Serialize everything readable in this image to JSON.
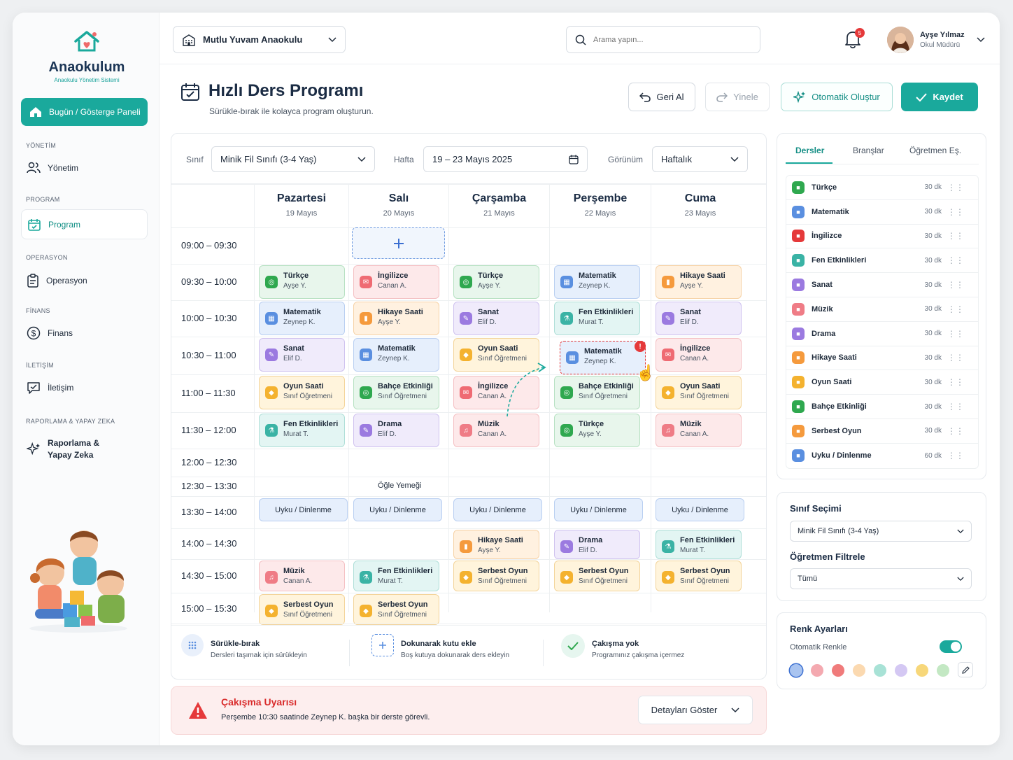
{
  "brand": {
    "name": "Anaokulum",
    "tagline": "Anaokulu Yönetim Sistemi"
  },
  "sidebar": {
    "dashboard_label": "Bugün / Gösterge Paneli",
    "sections": [
      {
        "title": "YÖNETİM",
        "item": "Yönetim",
        "icon": "users-icon"
      },
      {
        "title": "PROGRAM",
        "item": "Program",
        "icon": "calendar-icon",
        "active": true
      },
      {
        "title": "OPERASYON",
        "item": "Operasyon",
        "icon": "clipboard-icon"
      },
      {
        "title": "FİNANS",
        "item": "Finans",
        "icon": "dollar-icon"
      },
      {
        "title": "İLETİŞİM",
        "item": "İletişim",
        "icon": "chat-icon"
      },
      {
        "title": "RAPORLAMA & YAPAY ZEKA",
        "item": "Raporlama &",
        "item2": "Yapay Zeka",
        "icon": "sparkle-icon"
      }
    ]
  },
  "topbar": {
    "school": "Mutlu Yuvam Anaokulu",
    "search_placeholder": "Arama yapın...",
    "notifications": "5",
    "user_name": "Ayşe Yılmaz",
    "user_role": "Okul Müdürü"
  },
  "header": {
    "title": "Hızlı Ders Programı",
    "subtitle": "Sürükle-bırak ile kolayca program oluşturun.",
    "undo": "Geri Al",
    "redo": "Yinele",
    "auto": "Otomatik Oluştur",
    "save": "Kaydet"
  },
  "filters": {
    "class_label": "Sınıf",
    "class_value": "Minik Fil Sınıfı (3-4 Yaş)",
    "week_label": "Hafta",
    "week_value": "19 – 23 Mayıs 2025",
    "view_label": "Görünüm",
    "view_value": "Haftalık"
  },
  "days": [
    {
      "name": "Pazartesi",
      "date": "19 Mayıs"
    },
    {
      "name": "Salı",
      "date": "20 Mayıs"
    },
    {
      "name": "Çarşamba",
      "date": "21 Mayıs"
    },
    {
      "name": "Perşembe",
      "date": "22 Mayıs"
    },
    {
      "name": "Cuma",
      "date": "23 Mayıs"
    }
  ],
  "times": [
    "09:00 – 09:30",
    "09:30 – 10:00",
    "10:00 – 10:30",
    "10:30 – 11:00",
    "11:00 – 11:30",
    "11:30 – 12:00",
    "12:00 – 12:30",
    "12:30 – 13:30",
    "13:30 – 14:00",
    "14:00 – 14:30",
    "14:30 – 15:00",
    "15:00 – 15:30"
  ],
  "lunch": "Öğle Yemeği",
  "sleep_label": "Uyku / Dinlenme",
  "lessons": [
    {
      "day": 0,
      "slot": 1,
      "title": "Türkçe",
      "teacher": "Ayşe Y.",
      "color": "green"
    },
    {
      "day": 1,
      "slot": 1,
      "title": "İngilizce",
      "teacher": "Canan A.",
      "color": "red"
    },
    {
      "day": 2,
      "slot": 1,
      "title": "Türkçe",
      "teacher": "Ayşe Y.",
      "color": "green"
    },
    {
      "day": 3,
      "slot": 1,
      "title": "Matematik",
      "teacher": "Zeynep K.",
      "color": "blue"
    },
    {
      "day": 4,
      "slot": 1,
      "title": "Hikaye Saati",
      "teacher": "Ayşe Y.",
      "color": "orange"
    },
    {
      "day": 0,
      "slot": 2,
      "title": "Matematik",
      "teacher": "Zeynep K.",
      "color": "blue"
    },
    {
      "day": 1,
      "slot": 2,
      "title": "Hikaye Saati",
      "teacher": "Ayşe Y.",
      "color": "orange"
    },
    {
      "day": 2,
      "slot": 2,
      "title": "Sanat",
      "teacher": "Elif D.",
      "color": "purple"
    },
    {
      "day": 3,
      "slot": 2,
      "title": "Fen Etkinlikleri",
      "teacher": "Murat T.",
      "color": "teal"
    },
    {
      "day": 4,
      "slot": 2,
      "title": "Sanat",
      "teacher": "Elif D.",
      "color": "purple"
    },
    {
      "day": 0,
      "slot": 3,
      "title": "Sanat",
      "teacher": "Elif D.",
      "color": "purple"
    },
    {
      "day": 1,
      "slot": 3,
      "title": "Matematik",
      "teacher": "Zeynep K.",
      "color": "blue"
    },
    {
      "day": 2,
      "slot": 3,
      "title": "Oyun Saati",
      "teacher": "Sınıf Öğretmeni",
      "color": "yellow"
    },
    {
      "day": 3,
      "slot": 3,
      "title": "Matematik",
      "teacher": "Zeynep K.",
      "color": "blue",
      "conflict": true
    },
    {
      "day": 4,
      "slot": 3,
      "title": "İngilizce",
      "teacher": "Canan A.",
      "color": "red"
    },
    {
      "day": 0,
      "slot": 4,
      "title": "Oyun Saati",
      "teacher": "Sınıf Öğretmeni",
      "color": "yellow"
    },
    {
      "day": 1,
      "slot": 4,
      "title": "Bahçe Etkinliği",
      "teacher": "Sınıf Öğretmeni",
      "color": "green"
    },
    {
      "day": 2,
      "slot": 4,
      "title": "İngilizce",
      "teacher": "Canan A.",
      "color": "red"
    },
    {
      "day": 3,
      "slot": 4,
      "title": "Bahçe Etkinliği",
      "teacher": "Sınıf Öğretmeni",
      "color": "green"
    },
    {
      "day": 4,
      "slot": 4,
      "title": "Oyun Saati",
      "teacher": "Sınıf Öğretmeni",
      "color": "yellow"
    },
    {
      "day": 0,
      "slot": 5,
      "title": "Fen Etkinlikleri",
      "teacher": "Murat T.",
      "color": "teal"
    },
    {
      "day": 1,
      "slot": 5,
      "title": "Drama",
      "teacher": "Elif D.",
      "color": "purple"
    },
    {
      "day": 2,
      "slot": 5,
      "title": "Müzik",
      "teacher": "Canan A.",
      "color": "pink"
    },
    {
      "day": 3,
      "slot": 5,
      "title": "Türkçe",
      "teacher": "Ayşe Y.",
      "color": "green"
    },
    {
      "day": 4,
      "slot": 5,
      "title": "Müzik",
      "teacher": "Canan A.",
      "color": "pink"
    },
    {
      "day": 2,
      "slot": 9,
      "title": "Hikaye Saati",
      "teacher": "Ayşe Y.",
      "color": "orange"
    },
    {
      "day": 3,
      "slot": 9,
      "title": "Drama",
      "teacher": "Elif D.",
      "color": "purple"
    },
    {
      "day": 4,
      "slot": 9,
      "title": "Fen Etkinlikleri",
      "teacher": "Murat T.",
      "color": "teal"
    },
    {
      "day": 0,
      "slot": 10,
      "title": "Müzik",
      "teacher": "Canan A.",
      "color": "pink"
    },
    {
      "day": 1,
      "slot": 10,
      "title": "Fen Etkinlikleri",
      "teacher": "Murat T.",
      "color": "teal"
    },
    {
      "day": 2,
      "slot": 10,
      "title": "Serbest Oyun",
      "teacher": "Sınıf Öğretmeni",
      "color": "yellow"
    },
    {
      "day": 3,
      "slot": 10,
      "title": "Serbest Oyun",
      "teacher": "Sınıf Öğretmeni",
      "color": "yellow"
    },
    {
      "day": 4,
      "slot": 10,
      "title": "Serbest Oyun",
      "teacher": "Sınıf Öğretmeni",
      "color": "yellow"
    },
    {
      "day": 0,
      "slot": 11,
      "title": "Serbest Oyun",
      "teacher": "Sınıf Öğretmeni",
      "color": "yellow"
    },
    {
      "day": 1,
      "slot": 11,
      "title": "Serbest Oyun",
      "teacher": "Sınıf Öğretmeni",
      "color": "yellow"
    }
  ],
  "tips": [
    {
      "title": "Sürükle-bırak",
      "desc": "Dersleri taşımak için sürükleyin"
    },
    {
      "title": "Dokunarak kutu ekle",
      "desc": "Boş kutuya dokunarak ders ekleyin"
    },
    {
      "title": "Çakışma yok",
      "desc": "Programınız çakışma içermez"
    }
  ],
  "warning": {
    "title": "Çakışma Uyarısı",
    "text": "Perşembe 10:30 saatinde Zeynep K. başka bir derste görevli.",
    "button": "Detayları Göster"
  },
  "panel": {
    "tabs": [
      "Dersler",
      "Branşlar",
      "Öğretmen Eş."
    ],
    "subjects": [
      {
        "name": "Türkçe",
        "dur": "30 dk",
        "color": "#2fa84f"
      },
      {
        "name": "Matematik",
        "dur": "30 dk",
        "color": "#5a8fe0"
      },
      {
        "name": "İngilizce",
        "dur": "30 dk",
        "color": "#e5393a"
      },
      {
        "name": "Fen Etkinlikleri",
        "dur": "30 dk",
        "color": "#3ab3a5"
      },
      {
        "name": "Sanat",
        "dur": "30 dk",
        "color": "#9b7ae0"
      },
      {
        "name": "Müzik",
        "dur": "30 dk",
        "color": "#ef7c86"
      },
      {
        "name": "Drama",
        "dur": "30 dk",
        "color": "#9b7ae0"
      },
      {
        "name": "Hikaye Saati",
        "dur": "30 dk",
        "color": "#f59a3d"
      },
      {
        "name": "Oyun Saati",
        "dur": "30 dk",
        "color": "#f4b22f"
      },
      {
        "name": "Bahçe Etkinliği",
        "dur": "30 dk",
        "color": "#2fa84f"
      },
      {
        "name": "Serbest Oyun",
        "dur": "30 dk",
        "color": "#f59a3d"
      },
      {
        "name": "Uyku / Dinlenme",
        "dur": "60 dk",
        "color": "#5a8fe0"
      }
    ],
    "class_title": "Sınıf Seçimi",
    "class_value": "Minik Fil Sınıfı (3-4 Yaş)",
    "teacher_title": "Öğretmen Filtrele",
    "teacher_value": "Tümü",
    "color_title": "Renk Ayarları",
    "auto_color": "Otomatik Renkle",
    "swatches": [
      "#a9c4f0",
      "#f4a9b0",
      "#f07b7b",
      "#fbd9b0",
      "#a8e2d6",
      "#d4c8f3",
      "#f7d77a",
      "#c3e8c3"
    ]
  }
}
